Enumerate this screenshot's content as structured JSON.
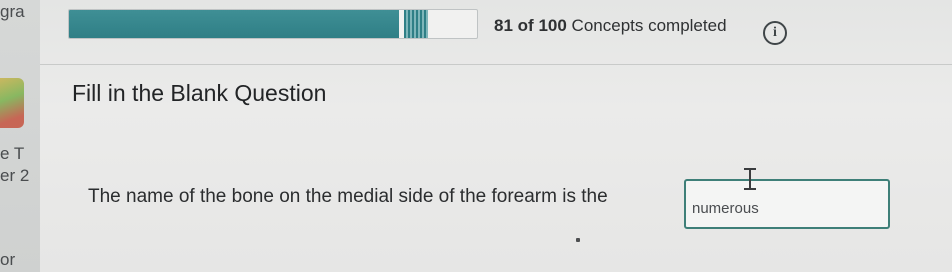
{
  "left_strip": {
    "fragments": [
      "gra",
      "e T",
      "er 2",
      "or"
    ]
  },
  "progress": {
    "completed": "81",
    "separator": "of",
    "total": "100",
    "label": "Concepts completed",
    "fraction": 0.81,
    "fill_color": "#2f7f86"
  },
  "info_icon": {
    "glyph": "i",
    "icon": "info-circle-icon"
  },
  "question": {
    "title": "Fill in the Blank Question",
    "prompt": "The name of the bone on the medial side of the forearm is the",
    "answer_value": "numerous"
  },
  "colors": {
    "accent": "#3e7f78"
  }
}
